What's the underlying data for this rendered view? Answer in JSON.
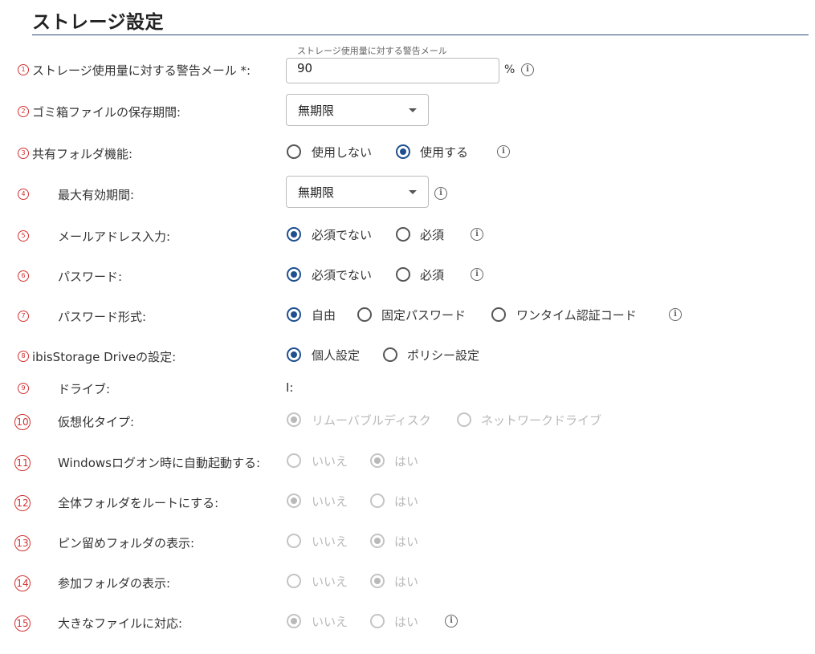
{
  "page": {
    "title": "ストレージ設定"
  },
  "rows": {
    "r1": {
      "num": "1",
      "label": "ストレージ使用量に対する警告メール *:",
      "legend": "ストレージ使用量に対する警告メール",
      "value": "90",
      "unit": "%"
    },
    "r2": {
      "num": "2",
      "label": "ゴミ箱ファイルの保存期間:",
      "select_value": "無期限"
    },
    "r3": {
      "num": "3",
      "label": "共有フォルダ機能:",
      "options": [
        "使用しない",
        "使用する"
      ],
      "selected": "使用する"
    },
    "r4": {
      "num": "4",
      "label": "最大有効期間:",
      "select_value": "無期限"
    },
    "r5": {
      "num": "5",
      "label": "メールアドレス入力:",
      "options": [
        "必須でない",
        "必須"
      ],
      "selected": "必須でない"
    },
    "r6": {
      "num": "6",
      "label": "パスワード:",
      "options": [
        "必須でない",
        "必須"
      ],
      "selected": "必須でない"
    },
    "r7": {
      "num": "7",
      "label": "パスワード形式:",
      "options": [
        "自由",
        "固定パスワード",
        "ワンタイム認証コード"
      ],
      "selected": "自由"
    },
    "r8": {
      "num": "8",
      "label": "ibisStorage Driveの設定:",
      "options": [
        "個人設定",
        "ポリシー設定"
      ],
      "selected": "個人設定"
    },
    "r9": {
      "num": "9",
      "label": "ドライブ:",
      "value": "I:"
    },
    "r10": {
      "num": "10",
      "label": "仮想化タイプ:",
      "options": [
        "リムーバブルディスク",
        "ネットワークドライブ"
      ],
      "selected": "リムーバブルディスク"
    },
    "r11": {
      "num": "11",
      "label": "Windowsログオン時に自動起動する:",
      "options": [
        "いいえ",
        "はい"
      ],
      "selected": "はい"
    },
    "r12": {
      "num": "12",
      "label": "全体フォルダをルートにする:",
      "options": [
        "いいえ",
        "はい"
      ],
      "selected": "いいえ"
    },
    "r13": {
      "num": "13",
      "label": "ピン留めフォルダの表示:",
      "options": [
        "いいえ",
        "はい"
      ],
      "selected": "はい"
    },
    "r14": {
      "num": "14",
      "label": "参加フォルダの表示:",
      "options": [
        "いいえ",
        "はい"
      ],
      "selected": "はい"
    },
    "r15": {
      "num": "15",
      "label": "大きなファイルに対応:",
      "options": [
        "いいえ",
        "はい"
      ],
      "selected": "いいえ"
    }
  },
  "icons": {
    "info": "info-circle-icon",
    "dropdown": "chevron-down-icon"
  },
  "colors": {
    "accent": "#1f4f8f",
    "marker": "#d23232",
    "disabled": "#b9b9b9",
    "rule": "#2a4a7a"
  }
}
